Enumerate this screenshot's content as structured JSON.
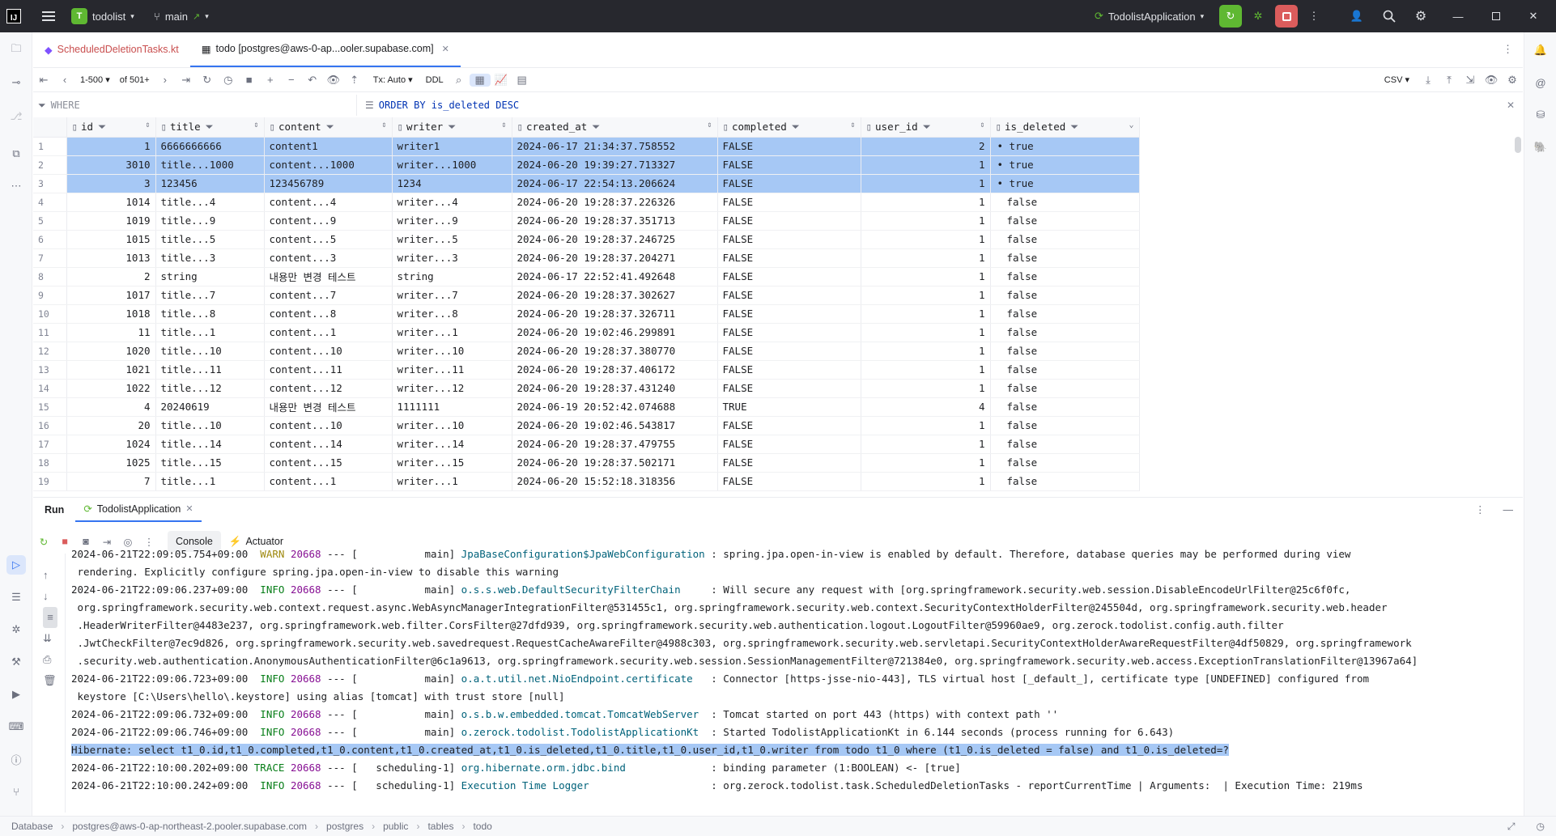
{
  "titlebar": {
    "project_initial": "T",
    "project": "todolist",
    "branch": "main",
    "run_config": "TodolistApplication"
  },
  "tabs": [
    {
      "label": "ScheduledDeletionTasks.kt"
    },
    {
      "label": "todo [postgres@aws-0-ap...ooler.supabase.com]"
    }
  ],
  "db_toolbar": {
    "page_range": "1-500",
    "of_total": "of 501+",
    "tx": "Tx: Auto",
    "ddl": "DDL",
    "export": "CSV"
  },
  "filter": {
    "where_placeholder": "WHERE",
    "order_by": "ORDER BY is_deleted DESC"
  },
  "grid": {
    "columns": [
      "id",
      "title",
      "content",
      "writer",
      "created_at",
      "completed",
      "user_id",
      "is_deleted"
    ],
    "rows": [
      {
        "n": "1",
        "id": "1",
        "title": "6666666666",
        "content": "content1",
        "writer": "writer1",
        "created_at": "2024-06-17 21:34:37.758552",
        "completed": "FALSE",
        "user_id": "2",
        "is_deleted": "true",
        "sel": true
      },
      {
        "n": "2",
        "id": "3010",
        "title": "title...1000",
        "content": "content...1000",
        "writer": "writer...1000",
        "created_at": "2024-06-20 19:39:27.713327",
        "completed": "FALSE",
        "user_id": "1",
        "is_deleted": "true",
        "sel": true
      },
      {
        "n": "3",
        "id": "3",
        "title": "123456",
        "content": "123456789",
        "writer": "1234",
        "created_at": "2024-06-17 22:54:13.206624",
        "completed": "FALSE",
        "user_id": "1",
        "is_deleted": "true",
        "sel": true
      },
      {
        "n": "4",
        "id": "1014",
        "title": "title...4",
        "content": "content...4",
        "writer": "writer...4",
        "created_at": "2024-06-20 19:28:37.226326",
        "completed": "FALSE",
        "user_id": "1",
        "is_deleted": "false"
      },
      {
        "n": "5",
        "id": "1019",
        "title": "title...9",
        "content": "content...9",
        "writer": "writer...9",
        "created_at": "2024-06-20 19:28:37.351713",
        "completed": "FALSE",
        "user_id": "1",
        "is_deleted": "false"
      },
      {
        "n": "6",
        "id": "1015",
        "title": "title...5",
        "content": "content...5",
        "writer": "writer...5",
        "created_at": "2024-06-20 19:28:37.246725",
        "completed": "FALSE",
        "user_id": "1",
        "is_deleted": "false"
      },
      {
        "n": "7",
        "id": "1013",
        "title": "title...3",
        "content": "content...3",
        "writer": "writer...3",
        "created_at": "2024-06-20 19:28:37.204271",
        "completed": "FALSE",
        "user_id": "1",
        "is_deleted": "false"
      },
      {
        "n": "8",
        "id": "2",
        "title": "string",
        "content": "내용만 변경 테스트",
        "writer": "string",
        "created_at": "2024-06-17 22:52:41.492648",
        "completed": "FALSE",
        "user_id": "1",
        "is_deleted": "false"
      },
      {
        "n": "9",
        "id": "1017",
        "title": "title...7",
        "content": "content...7",
        "writer": "writer...7",
        "created_at": "2024-06-20 19:28:37.302627",
        "completed": "FALSE",
        "user_id": "1",
        "is_deleted": "false"
      },
      {
        "n": "10",
        "id": "1018",
        "title": "title...8",
        "content": "content...8",
        "writer": "writer...8",
        "created_at": "2024-06-20 19:28:37.326711",
        "completed": "FALSE",
        "user_id": "1",
        "is_deleted": "false"
      },
      {
        "n": "11",
        "id": "11",
        "title": "title...1",
        "content": "content...1",
        "writer": "writer...1",
        "created_at": "2024-06-20 19:02:46.299891",
        "completed": "FALSE",
        "user_id": "1",
        "is_deleted": "false"
      },
      {
        "n": "12",
        "id": "1020",
        "title": "title...10",
        "content": "content...10",
        "writer": "writer...10",
        "created_at": "2024-06-20 19:28:37.380770",
        "completed": "FALSE",
        "user_id": "1",
        "is_deleted": "false"
      },
      {
        "n": "13",
        "id": "1021",
        "title": "title...11",
        "content": "content...11",
        "writer": "writer...11",
        "created_at": "2024-06-20 19:28:37.406172",
        "completed": "FALSE",
        "user_id": "1",
        "is_deleted": "false"
      },
      {
        "n": "14",
        "id": "1022",
        "title": "title...12",
        "content": "content...12",
        "writer": "writer...12",
        "created_at": "2024-06-20 19:28:37.431240",
        "completed": "FALSE",
        "user_id": "1",
        "is_deleted": "false"
      },
      {
        "n": "15",
        "id": "4",
        "title": "20240619",
        "content": "내용만 변경 테스트",
        "writer": "1111111",
        "created_at": "2024-06-19 20:52:42.074688",
        "completed": "TRUE",
        "user_id": "4",
        "is_deleted": "false"
      },
      {
        "n": "16",
        "id": "20",
        "title": "title...10",
        "content": "content...10",
        "writer": "writer...10",
        "created_at": "2024-06-20 19:02:46.543817",
        "completed": "FALSE",
        "user_id": "1",
        "is_deleted": "false"
      },
      {
        "n": "17",
        "id": "1024",
        "title": "title...14",
        "content": "content...14",
        "writer": "writer...14",
        "created_at": "2024-06-20 19:28:37.479755",
        "completed": "FALSE",
        "user_id": "1",
        "is_deleted": "false"
      },
      {
        "n": "18",
        "id": "1025",
        "title": "title...15",
        "content": "content...15",
        "writer": "writer...15",
        "created_at": "2024-06-20 19:28:37.502171",
        "completed": "FALSE",
        "user_id": "1",
        "is_deleted": "false"
      },
      {
        "n": "19",
        "id": "7",
        "title": "title...1",
        "content": "content...1",
        "writer": "writer...1",
        "created_at": "2024-06-20 15:52:18.318356",
        "completed": "FALSE",
        "user_id": "1",
        "is_deleted": "false"
      }
    ]
  },
  "run": {
    "label": "Run",
    "tab": "TodolistApplication",
    "console": "Console",
    "actuator": "Actuator"
  },
  "console": [
    {
      "parts": [
        {
          "t": "2024-06-21T22:09:05.754+09:00  "
        },
        {
          "t": "WARN",
          "c": "lvl-warn"
        },
        {
          "t": " "
        },
        {
          "t": "20668",
          "c": "pid"
        },
        {
          "t": " --- [           main] "
        },
        {
          "t": "JpaBaseConfiguration$JpaWebConfiguration",
          "c": "lg"
        },
        {
          "t": " : spring.jpa.open-in-view is enabled by default. Therefore, database queries may be performed during view"
        }
      ]
    },
    {
      "parts": [
        {
          "t": " rendering. Explicitly configure spring.jpa.open-in-view to disable this warning"
        }
      ]
    },
    {
      "parts": [
        {
          "t": "2024-06-21T22:09:06.237+09:00  "
        },
        {
          "t": "INFO",
          "c": "lvl-info"
        },
        {
          "t": " "
        },
        {
          "t": "20668",
          "c": "pid"
        },
        {
          "t": " --- [           main] "
        },
        {
          "t": "o.s.s.web.DefaultSecurityFilterChain",
          "c": "lg"
        },
        {
          "t": "     : Will secure any request with [org.springframework.security.web.session.DisableEncodeUrlFilter@25c6f0fc,"
        }
      ]
    },
    {
      "parts": [
        {
          "t": " org.springframework.security.web.context.request.async.WebAsyncManagerIntegrationFilter@531455c1, org.springframework.security.web.context.SecurityContextHolderFilter@245504d, org.springframework.security.web.header"
        }
      ]
    },
    {
      "parts": [
        {
          "t": " .HeaderWriterFilter@4483e237, org.springframework.web.filter.CorsFilter@27dfd939, org.springframework.security.web.authentication.logout.LogoutFilter@59960ae9, org.zerock.todolist.config.auth.filter"
        }
      ]
    },
    {
      "parts": [
        {
          "t": " .JwtCheckFilter@7ec9d826, org.springframework.security.web.savedrequest.RequestCacheAwareFilter@4988c303, org.springframework.security.web.servletapi.SecurityContextHolderAwareRequestFilter@4df50829, org.springframework"
        }
      ]
    },
    {
      "parts": [
        {
          "t": " .security.web.authentication.AnonymousAuthenticationFilter@6c1a9613, org.springframework.security.web.session.SessionManagementFilter@721384e0, org.springframework.security.web.access.ExceptionTranslationFilter@13967a64]"
        }
      ]
    },
    {
      "parts": [
        {
          "t": "2024-06-21T22:09:06.723+09:00  "
        },
        {
          "t": "INFO",
          "c": "lvl-info"
        },
        {
          "t": " "
        },
        {
          "t": "20668",
          "c": "pid"
        },
        {
          "t": " --- [           main] "
        },
        {
          "t": "o.a.t.util.net.NioEndpoint.certificate",
          "c": "lg"
        },
        {
          "t": "   : Connector [https-jsse-nio-443], TLS virtual host [_default_], certificate type [UNDEFINED] configured from"
        }
      ]
    },
    {
      "parts": [
        {
          "t": " keystore [C:\\Users\\hello\\.keystore] using alias [tomcat] with trust store [null]"
        }
      ]
    },
    {
      "parts": [
        {
          "t": "2024-06-21T22:09:06.732+09:00  "
        },
        {
          "t": "INFO",
          "c": "lvl-info"
        },
        {
          "t": " "
        },
        {
          "t": "20668",
          "c": "pid"
        },
        {
          "t": " --- [           main] "
        },
        {
          "t": "o.s.b.w.embedded.tomcat.TomcatWebServer",
          "c": "lg"
        },
        {
          "t": "  : Tomcat started on port 443 (https) with context path ''"
        }
      ]
    },
    {
      "parts": [
        {
          "t": "2024-06-21T22:09:06.746+09:00  "
        },
        {
          "t": "INFO",
          "c": "lvl-info"
        },
        {
          "t": " "
        },
        {
          "t": "20668",
          "c": "pid"
        },
        {
          "t": " --- [           main] "
        },
        {
          "t": "o.zerock.todolist.TodolistApplicationKt",
          "c": "lg"
        },
        {
          "t": "  : Started TodolistApplicationKt in 6.144 seconds (process running for 6.643)"
        }
      ]
    },
    {
      "parts": [
        {
          "t": "Hibernate: select t1_0.id,t1_0.completed,t1_0.content,t1_0.created_at,t1_0.is_deleted,t1_0.title,t1_0.user_id,t1_0.writer from todo t1_0 where (t1_0.is_deleted = false) and t1_0.is_deleted=?",
          "c": "hl"
        }
      ]
    },
    {
      "parts": [
        {
          "t": "2024-06-21T22:10:00.202+09:00 "
        },
        {
          "t": "TRACE",
          "c": "lvl-trace"
        },
        {
          "t": " "
        },
        {
          "t": "20668",
          "c": "pid"
        },
        {
          "t": " --- [   scheduling-1] "
        },
        {
          "t": "org.hibernate.orm.jdbc.bind",
          "c": "lg"
        },
        {
          "t": "              : binding parameter (1:BOOLEAN) <- [true]"
        }
      ]
    },
    {
      "parts": [
        {
          "t": "2024-06-21T22:10:00.242+09:00  "
        },
        {
          "t": "INFO",
          "c": "lvl-info"
        },
        {
          "t": " "
        },
        {
          "t": "20668",
          "c": "pid"
        },
        {
          "t": " --- [   scheduling-1] "
        },
        {
          "t": "Execution Time Logger",
          "c": "lg"
        },
        {
          "t": "                    : org.zerock.todolist.task.ScheduledDeletionTasks - reportCurrentTime | Arguments:  | Execution Time: 219ms"
        }
      ]
    }
  ],
  "statusbar": {
    "crumbs": [
      "Database",
      "postgres@aws-0-ap-northeast-2.pooler.supabase.com",
      "postgres",
      "public",
      "tables",
      "todo"
    ]
  },
  "colors": {
    "accent": "#3574f0",
    "selection": "#a6c8f5",
    "run_green": "#5fb832",
    "stop_red": "#db5c5c"
  }
}
